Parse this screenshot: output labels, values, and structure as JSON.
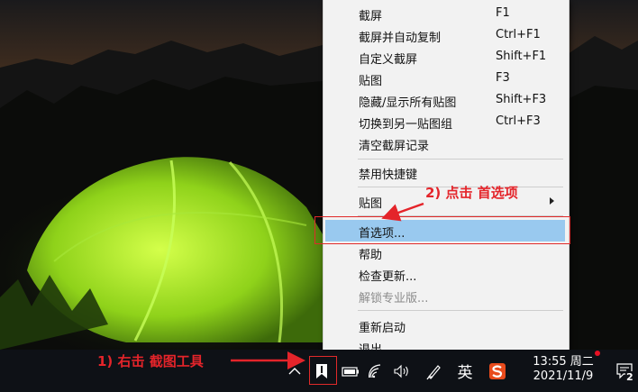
{
  "menu": {
    "items": [
      {
        "label": "截屏",
        "shortcut": "F1"
      },
      {
        "label": "截屏并自动复制",
        "shortcut": "Ctrl+F1"
      },
      {
        "label": "自定义截屏",
        "shortcut": "Shift+F1"
      },
      {
        "label": "贴图",
        "shortcut": "F3"
      },
      {
        "label": "隐藏/显示所有贴图",
        "shortcut": "Shift+F3"
      },
      {
        "label": "切换到另一贴图组",
        "shortcut": "Ctrl+F3"
      },
      {
        "label": "清空截屏记录",
        "shortcut": ""
      },
      {
        "label": "禁用快捷键",
        "shortcut": ""
      },
      {
        "label": "贴图",
        "shortcut": ""
      },
      {
        "label": "首选项...",
        "shortcut": ""
      },
      {
        "label": "帮助",
        "shortcut": ""
      },
      {
        "label": "检查更新...",
        "shortcut": ""
      },
      {
        "label": "解锁专业版...",
        "shortcut": ""
      },
      {
        "label": "重新启动",
        "shortcut": ""
      },
      {
        "label": "退出",
        "shortcut": ""
      }
    ]
  },
  "annotations": {
    "step1": "1) 右击 截图工具",
    "step2": "2) 点击 首选项"
  },
  "taskbar": {
    "ime": "英",
    "time": "13:55 周二",
    "date": "2021/11/9",
    "notification_count": "2"
  },
  "colors": {
    "menu_bg": "#f2f2f2",
    "highlight": "#99c9ef",
    "annotation_red": "#e4242a",
    "taskbar_bg": "#0e1116"
  }
}
